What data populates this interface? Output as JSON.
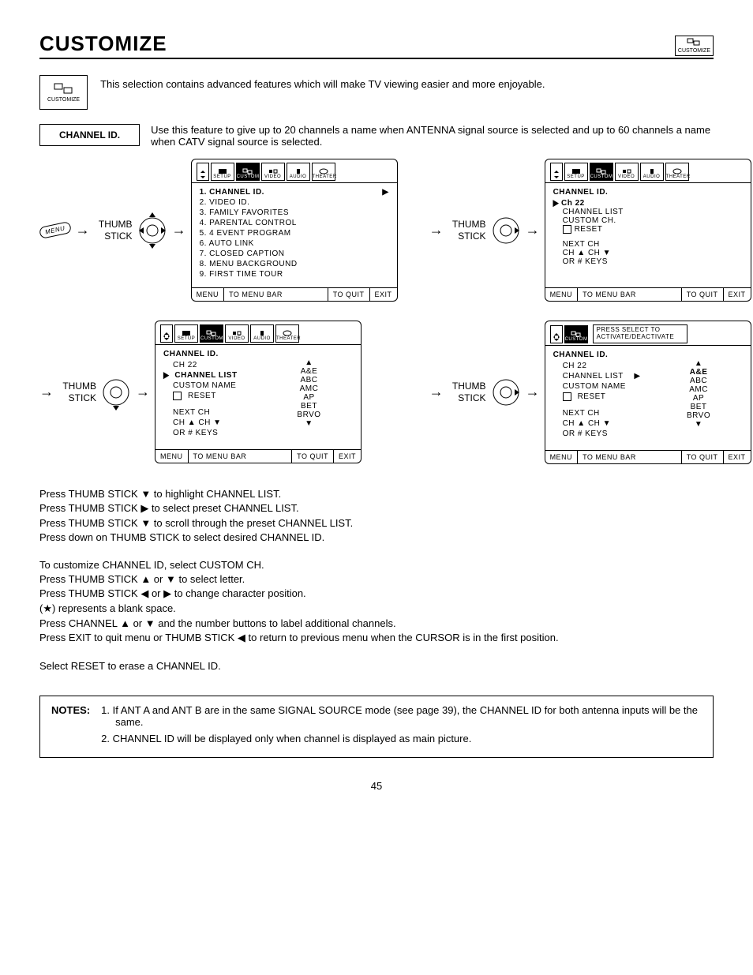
{
  "page": {
    "title": "CUSTOMIZE",
    "number": "45",
    "iconLabel": "CUSTOMIZE"
  },
  "intro": "This selection contains advanced features which will make TV viewing easier and more enjoyable.",
  "feature": {
    "label": "CHANNEL ID.",
    "text": "Use this feature to give up to 20 channels a name when ANTENNA signal source is selected and up to 60 channels a name when CATV signal source is selected."
  },
  "labels": {
    "thumbStick": "THUMB STICK",
    "menu": "MENU"
  },
  "tabs": {
    "setup": "SETUP",
    "customize": "CUSTOMIZE",
    "video": "VIDEO",
    "audio": "AUDIO",
    "theater": "THEATER"
  },
  "menuFooter": {
    "menu": "MENU",
    "toBar": "TO MENU BAR",
    "toQuit": "TO QUIT",
    "exit": "EXIT"
  },
  "screen1": {
    "items": [
      "1.  CHANNEL ID.",
      "2.  VIDEO ID.",
      "3.  FAMILY FAVORITES",
      "4.  PARENTAL CONTROL",
      "5.  4 EVENT PROGRAM",
      "6.  AUTO LINK",
      "7.  CLOSED CAPTION",
      "8.  MENU BACKGROUND",
      "9.  FIRST TIME TOUR"
    ]
  },
  "screen2": {
    "title": "CHANNEL ID.",
    "ch": "Ch 22",
    "list": "CHANNEL LIST",
    "custom": "CUSTOM CH.",
    "reset": "RESET",
    "next": "NEXT CH",
    "chNav": "CH ▲ CH ▼",
    "orKeys": "OR # KEYS"
  },
  "screen3": {
    "title": "CHANNEL ID.",
    "ch": "CH 22",
    "list": "CHANNEL LIST",
    "custom": "CUSTOM NAME",
    "reset": "RESET",
    "next": "NEXT CH",
    "chNav": "CH ▲ CH ▼",
    "orKeys": "OR # KEYS",
    "presets": [
      "▲",
      "A&E",
      "ABC",
      "AMC",
      "AP",
      "BET",
      "BRVO",
      "▼"
    ]
  },
  "screen4": {
    "title": "CHANNEL ID.",
    "hint": "PRESS SELECT TO ACTIVATE/DEACTIVATE",
    "ch": "CH 22",
    "list": "CHANNEL LIST",
    "custom": "CUSTOM NAME",
    "reset": "RESET",
    "next": "NEXT CH",
    "chNav": "CH ▲ CH ▼",
    "orKeys": "OR # KEYS",
    "sel": "A&E",
    "presets": [
      "▲",
      "A&E",
      "ABC",
      "AMC",
      "AP",
      "BET",
      "BRVO",
      "▼"
    ]
  },
  "instructions": {
    "l1": "Press THUMB STICK  ▼ to highlight CHANNEL LIST.",
    "l2": "Press THUMB STICK ▶ to select preset CHANNEL LIST.",
    "l3": "Press THUMB STICK ▼ to scroll through the preset CHANNEL LIST.",
    "l4": "Press down on THUMB STICK to select desired CHANNEL ID.",
    "l5": "To customize CHANNEL ID, select CUSTOM CH.",
    "l6": "Press THUMB STICK ▲ or ▼ to select letter.",
    "l7": "Press THUMB STICK ◀ or ▶ to change character position.",
    "l8": "(★) represents a blank space.",
    "l9": "Press CHANNEL ▲ or ▼  and the number buttons to label additional channels.",
    "l10": "Press EXIT to quit menu or THUMB STICK ◀ to return to previous menu when the CURSOR is in the first position.",
    "l11": "Select RESET to erase a CHANNEL ID."
  },
  "notes": {
    "label": "NOTES:",
    "n1": "If ANT A and ANT B are in the same SIGNAL SOURCE mode (see page 39), the CHANNEL ID for both antenna inputs will be the same.",
    "n2": "CHANNEL ID will be displayed only when channel is displayed as main picture."
  }
}
